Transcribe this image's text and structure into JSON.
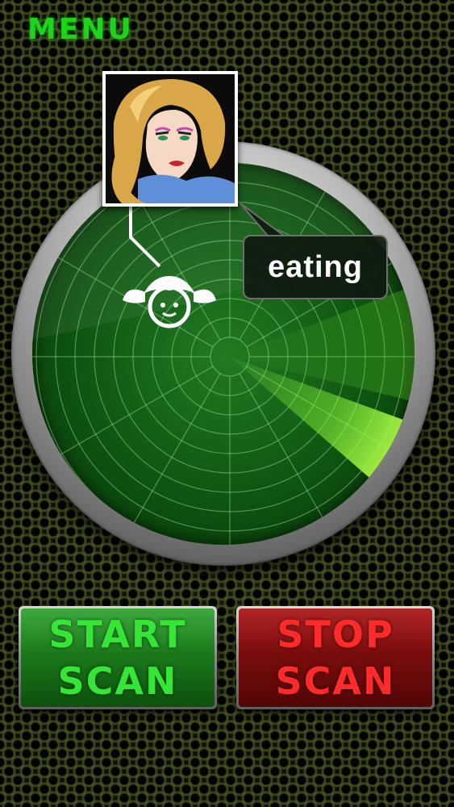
{
  "header": {
    "menu_label": "MENU"
  },
  "radar": {
    "status_text": "eating",
    "target_icon": "girl-face-icon",
    "photo": "target-portrait"
  },
  "controls": {
    "start_line1": "START",
    "start_line2": "SCAN",
    "stop_line1": "STOP",
    "stop_line2": "SCAN"
  },
  "colors": {
    "menu_green": "#1bd41b",
    "start_text": "#36e636",
    "stop_text": "#ff2a2a",
    "radar_green": "#0f5410",
    "sweep_green": "#8cff3a"
  }
}
